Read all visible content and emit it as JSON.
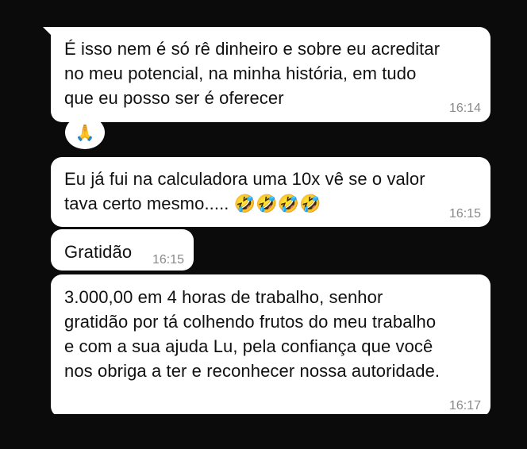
{
  "messages": [
    {
      "text": "É isso nem é só rê dinheiro e sobre eu acreditar\nno meu potencial, na minha história, em tudo\nque eu posso ser é oferecer",
      "time": "16:14",
      "reaction": "🙏"
    },
    {
      "text": "Eu já fui na calculadora uma 10x vê se o valor\ntava certo mesmo..... 🤣🤣🤣🤣",
      "time": "16:15"
    },
    {
      "text": "Gratidão",
      "time": "16:15"
    },
    {
      "text": "3.000,00 em 4 horas de trabalho, senhor\ngratidão por tá colhendo frutos do meu trabalho\ne com a sua ajuda Lu, pela confiança que você\nnos obriga a ter e reconhecer nossa autoridade.",
      "time": "16:17"
    }
  ],
  "colors": {
    "background": "#0b0b0b",
    "bubble": "#ffffff",
    "time": "#8a8a8a"
  }
}
